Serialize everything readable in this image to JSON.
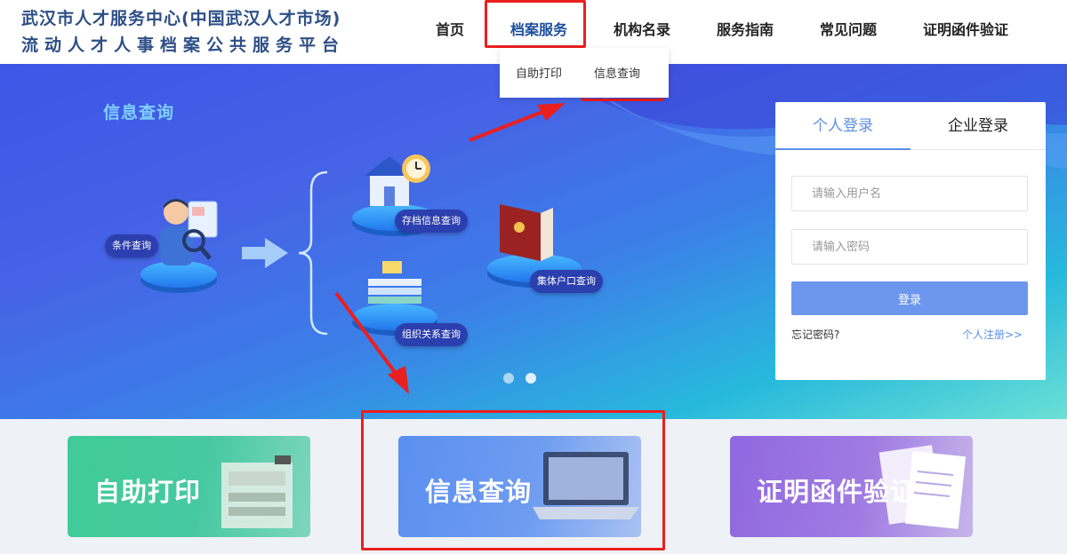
{
  "header": {
    "title_line1": "武汉市人才服务中心(中国武汉人才市场)",
    "title_line2": "流动人才人事档案公共服务平台",
    "nav": [
      {
        "label": "首页"
      },
      {
        "label": "档案服务"
      },
      {
        "label": "机构名录"
      },
      {
        "label": "服务指南"
      },
      {
        "label": "常见问题"
      },
      {
        "label": "证明函件验证"
      }
    ],
    "dropdown": [
      {
        "label": "自助打印"
      },
      {
        "label": "信息查询"
      }
    ]
  },
  "banner": {
    "title": "信息查询",
    "pills": {
      "condition": "条件查询",
      "archive": "存档信息查询",
      "org": "组织关系查询",
      "household": "集体户口查询"
    }
  },
  "login": {
    "tabs": [
      {
        "label": "个人登录"
      },
      {
        "label": "企业登录"
      }
    ],
    "username_placeholder": "请输入用户名",
    "password_placeholder": "请输入密码",
    "submit": "登录",
    "forgot": "忘记密码?",
    "register": "个人注册>>"
  },
  "cards": [
    {
      "label": "自助打印"
    },
    {
      "label": "信息查询"
    },
    {
      "label": "证明函件验证"
    }
  ],
  "colors": {
    "highlight": "#ea1f1f",
    "nav_active": "#1c4f9c",
    "title": "#2d4f86",
    "login_accent": "#5b8fe6"
  }
}
